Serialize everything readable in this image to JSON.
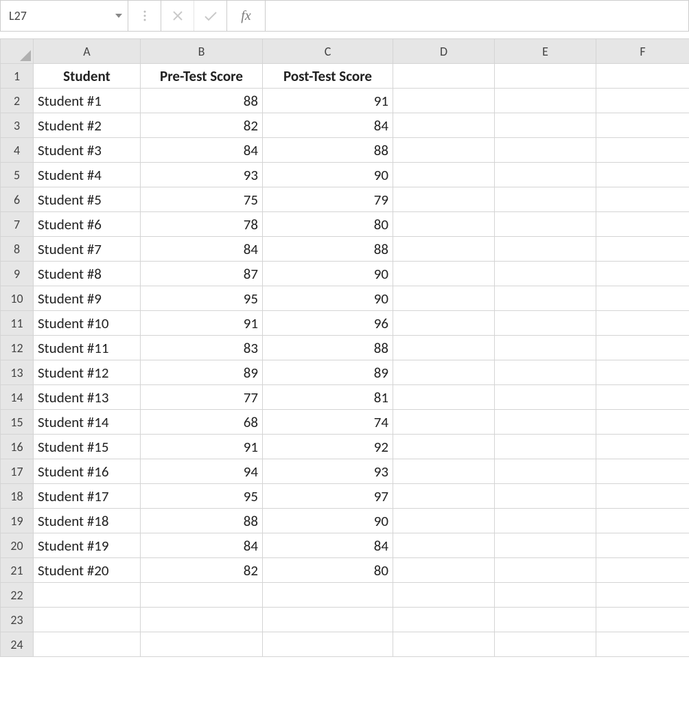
{
  "name_box": {
    "value": "L27"
  },
  "fx_label": "fx",
  "formula_input": "",
  "columns": [
    "A",
    "B",
    "C",
    "D",
    "E",
    "F"
  ],
  "row_headers": [
    "1",
    "2",
    "3",
    "4",
    "5",
    "6",
    "7",
    "8",
    "9",
    "10",
    "11",
    "12",
    "13",
    "14",
    "15",
    "16",
    "17",
    "18",
    "19",
    "20",
    "21",
    "22",
    "23",
    "24"
  ],
  "headers": {
    "A": "Student",
    "B": "Pre-Test Score",
    "C": "Post-Test Score"
  },
  "rows": [
    {
      "student": "Student #1",
      "pre": 88,
      "post": 91
    },
    {
      "student": "Student #2",
      "pre": 82,
      "post": 84
    },
    {
      "student": "Student #3",
      "pre": 84,
      "post": 88
    },
    {
      "student": "Student #4",
      "pre": 93,
      "post": 90
    },
    {
      "student": "Student #5",
      "pre": 75,
      "post": 79
    },
    {
      "student": "Student #6",
      "pre": 78,
      "post": 80
    },
    {
      "student": "Student #7",
      "pre": 84,
      "post": 88
    },
    {
      "student": "Student #8",
      "pre": 87,
      "post": 90
    },
    {
      "student": "Student #9",
      "pre": 95,
      "post": 90
    },
    {
      "student": "Student #10",
      "pre": 91,
      "post": 96
    },
    {
      "student": "Student #11",
      "pre": 83,
      "post": 88
    },
    {
      "student": "Student #12",
      "pre": 89,
      "post": 89
    },
    {
      "student": "Student #13",
      "pre": 77,
      "post": 81
    },
    {
      "student": "Student #14",
      "pre": 68,
      "post": 74
    },
    {
      "student": "Student #15",
      "pre": 91,
      "post": 92
    },
    {
      "student": "Student #16",
      "pre": 94,
      "post": 93
    },
    {
      "student": "Student #17",
      "pre": 95,
      "post": 97
    },
    {
      "student": "Student #18",
      "pre": 88,
      "post": 90
    },
    {
      "student": "Student #19",
      "pre": 84,
      "post": 84
    },
    {
      "student": "Student #20",
      "pre": 82,
      "post": 80
    }
  ]
}
